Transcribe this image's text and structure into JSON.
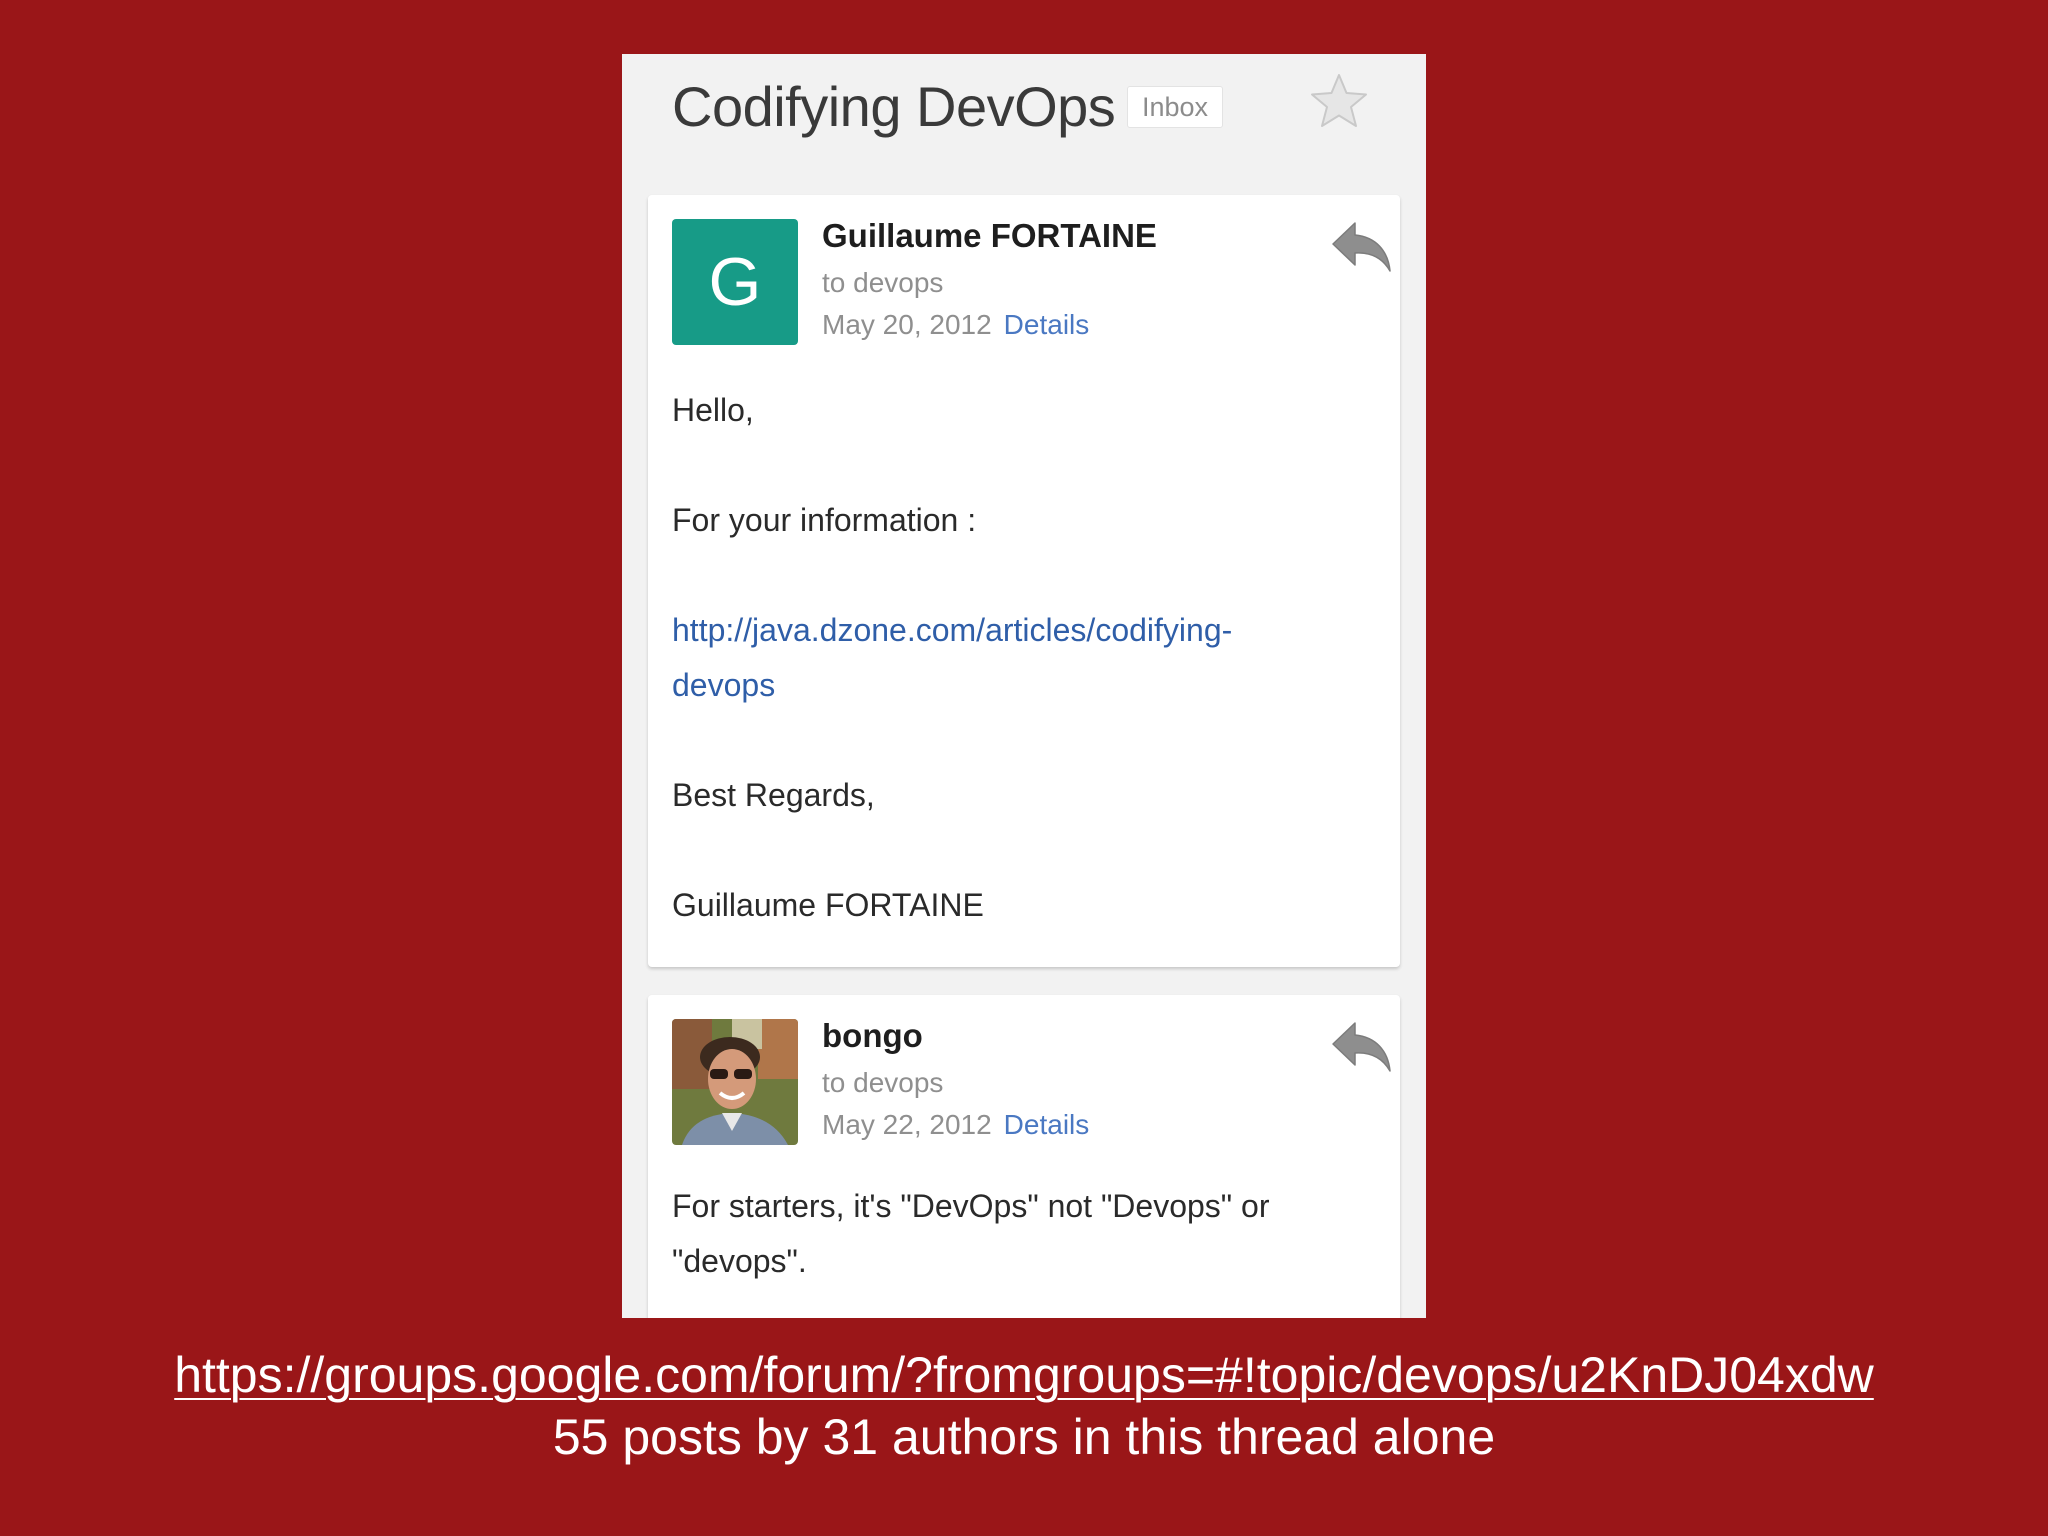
{
  "thread": {
    "title": "Codifying DevOps",
    "label": "Inbox",
    "star_icon": "star-outline-icon"
  },
  "messages": [
    {
      "avatar_letter": "G",
      "avatar_color": "#179b87",
      "sender": "Guillaume FORTAINE",
      "recipient": "to devops",
      "date": "May 20, 2012",
      "details_label": "Details",
      "reply_icon": "reply-icon",
      "body": {
        "greeting": "Hello,",
        "intro": "For your information :",
        "link_line1": "http://java.dzone.com/articles/codifying-",
        "link_line2": "devops",
        "closing": "Best Regards,",
        "signature": "Guillaume FORTAINE"
      }
    },
    {
      "avatar_type": "photo",
      "sender": "bongo",
      "recipient": "to devops",
      "date": "May 22, 2012",
      "details_label": "Details",
      "reply_icon": "reply-icon",
      "body": {
        "line1": "For starters, it's \"DevOps\" not \"Devops\" or",
        "line2": "\"devops\"."
      }
    }
  ],
  "footer": {
    "url": "https://groups.google.com/forum/?fromgroups=#!topic/devops/u2KnDJ04xdw",
    "caption": "55 posts by 31 authors in this thread alone"
  },
  "colors": {
    "background": "#9a1618",
    "link": "#2f5ea8",
    "details": "#4a78c2"
  }
}
